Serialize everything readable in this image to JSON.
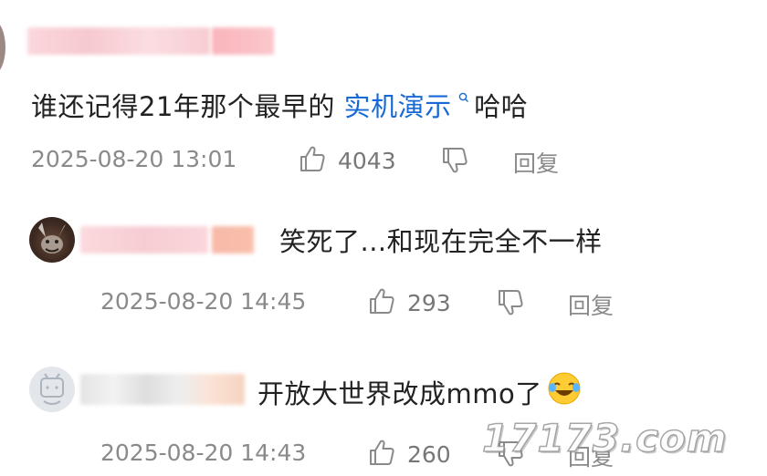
{
  "comments": [
    {
      "text_before": "谁还记得21年那个最早的 ",
      "link_text": "实机演示",
      "text_after": " 哈哈",
      "timestamp": "2025-08-20 13:01",
      "likes": "4043",
      "reply_label": "回复"
    },
    {
      "text": "笑死了...和现在完全不一样",
      "timestamp": "2025-08-20 14:45",
      "likes": "293",
      "reply_label": "回复"
    },
    {
      "text": "开放大世界改成mmo了",
      "timestamp": "2025-08-20 14:43",
      "likes": "260",
      "reply_label": "回复"
    }
  ],
  "icons": {
    "like": "thumbs-up-icon",
    "dislike": "thumbs-down-icon",
    "search": "search-icon",
    "emoji": "laughing-crying-emoji-icon"
  },
  "colors": {
    "link": "#1769d6",
    "meta": "#8a8a8a",
    "redacted_pink": "#f7c6cc"
  },
  "watermark": "17173.com"
}
